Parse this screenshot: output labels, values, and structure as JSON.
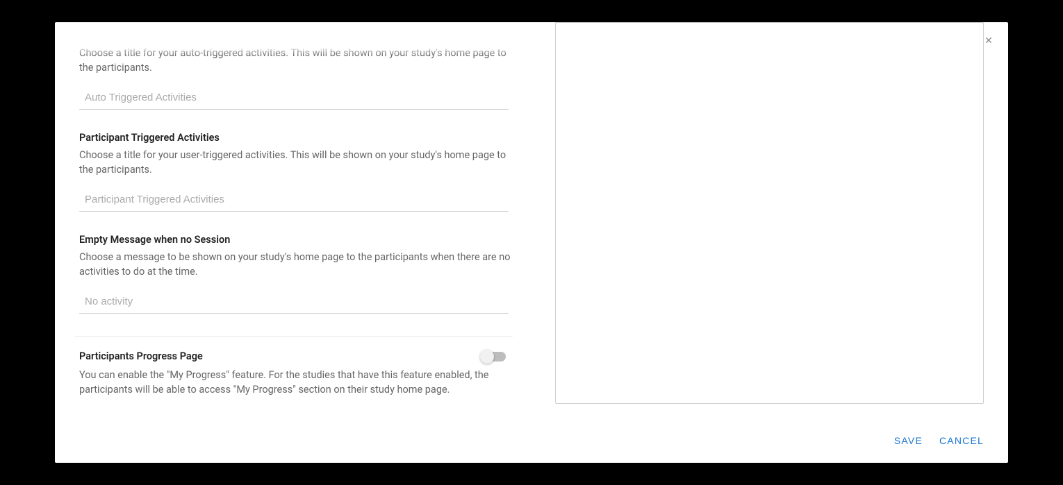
{
  "sections": {
    "auto_triggered": {
      "desc": "Choose a title for your auto-triggered activities. This will be shown on your study's home page to the participants.",
      "placeholder": "Auto Triggered Activities",
      "value": ""
    },
    "participant_triggered": {
      "title": "Participant Triggered Activities",
      "desc": "Choose a title for your user-triggered activities. This will be shown on your study's home page to the participants.",
      "placeholder": "Participant Triggered Activities",
      "value": ""
    },
    "empty_message": {
      "title": "Empty Message when no Session",
      "desc": "Choose a message to be shown on your study's home page to the participants when there are no activities to do at the time.",
      "placeholder": "No activity",
      "value": ""
    },
    "progress_page": {
      "title": "Participants Progress Page",
      "desc": "You can enable the \"My Progress\" feature. For the studies that have this feature enabled, the participants will be able to access \"My Progress\" section on their study home page."
    }
  },
  "footer": {
    "save": "Save",
    "cancel": "Cancel"
  }
}
